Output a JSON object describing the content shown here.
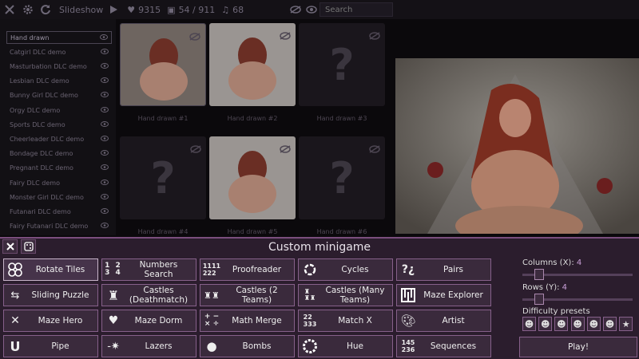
{
  "topbar": {
    "slideshow_label": "Slideshow",
    "hearts": "9315",
    "images": "54 / 911",
    "music": "68",
    "search_placeholder": "Search"
  },
  "categories": [
    {
      "label": "Hand drawn",
      "selected": true
    },
    {
      "label": "Catgirl DLC demo"
    },
    {
      "label": "Masturbation DLC demo"
    },
    {
      "label": "Lesbian DLC demo"
    },
    {
      "label": "Bunny Girl DLC demo"
    },
    {
      "label": "Orgy DLC demo"
    },
    {
      "label": "Sports DLC demo"
    },
    {
      "label": "Cheerleader DLC demo"
    },
    {
      "label": "Bondage DLC demo"
    },
    {
      "label": "Pregnant DLC demo"
    },
    {
      "label": "Fairy DLC demo"
    },
    {
      "label": "Monster Girl DLC demo"
    },
    {
      "label": "Futanari DLC demo"
    },
    {
      "label": "Fairy Futanari DLC demo"
    }
  ],
  "gallery": [
    {
      "caption": "Hand drawn #1",
      "locked": false
    },
    {
      "caption": "Hand drawn #2",
      "locked": false
    },
    {
      "caption": "Hand drawn #3",
      "locked": true
    },
    {
      "caption": "Hand drawn #4",
      "locked": true
    },
    {
      "caption": "Hand drawn #5",
      "locked": false
    },
    {
      "caption": "Hand drawn #6",
      "locked": true
    }
  ],
  "dialog": {
    "title": "Custom minigame",
    "games": [
      {
        "label": "Rotate Tiles",
        "icon": "rotate-tiles-icon",
        "selected": true
      },
      {
        "label": "Numbers Search",
        "icon": "numbers-icon"
      },
      {
        "label": "Proofreader",
        "icon": "proofreader-icon"
      },
      {
        "label": "Cycles",
        "icon": "cycles-icon"
      },
      {
        "label": "Pairs",
        "icon": "pairs-icon"
      },
      {
        "label": "Sliding Puzzle",
        "icon": "sliding-puzzle-icon"
      },
      {
        "label": "Castles (Deathmatch)",
        "icon": "castle-icon"
      },
      {
        "label": "Castles (2 Teams)",
        "icon": "castles-two-icon"
      },
      {
        "label": "Castles (Many Teams)",
        "icon": "castles-many-icon"
      },
      {
        "label": "Maze Explorer",
        "icon": "maze-icon"
      },
      {
        "label": "Maze Hero",
        "icon": "maze-hero-icon"
      },
      {
        "label": "Maze Dorm",
        "icon": "heart-horns-icon"
      },
      {
        "label": "Math Merge",
        "icon": "math-icon"
      },
      {
        "label": "Match X",
        "icon": "match-x-icon"
      },
      {
        "label": "Artist",
        "icon": "palette-icon"
      },
      {
        "label": "Pipe",
        "icon": "pipe-icon"
      },
      {
        "label": "Lazers",
        "icon": "laser-icon"
      },
      {
        "label": "Bombs",
        "icon": "bomb-icon"
      },
      {
        "label": "Hue",
        "icon": "hue-icon"
      },
      {
        "label": "Sequences",
        "icon": "sequence-icon"
      }
    ],
    "columns_label": "Columns (X):",
    "columns_value": "4",
    "rows_label": "Rows (Y):",
    "rows_value": "4",
    "presets_label": "Difficulty presets",
    "play_label": "Play!"
  },
  "colors": {
    "accent": "#86608a",
    "panel": "#2b1d2d",
    "value": "#c9a0d8"
  }
}
